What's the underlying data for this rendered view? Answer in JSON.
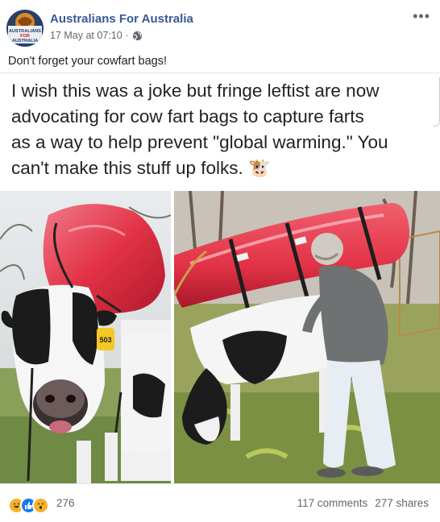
{
  "post": {
    "page_name": "Australians For Australia",
    "avatar_text": [
      "AUSTRALIANS",
      "FOR",
      "AUSTRALIA"
    ],
    "timestamp": "17 May at 07:10",
    "privacy_icon": "globe-icon",
    "more_icon": "more-options-icon",
    "caption": "Don't forget your cowfart bags!"
  },
  "image": {
    "text_lines": [
      "I wish this was a joke but fringe leftist are now",
      "advocating for cow fart bags to capture farts",
      "as a way to help prevent \"global warming.\" You",
      "can't make this stuff up folks. 🐮"
    ],
    "ear_tag": "503"
  },
  "footer": {
    "reaction_icons": [
      "haha-icon",
      "like-icon",
      "wow-icon"
    ],
    "reaction_count": "276",
    "comments": "117 comments",
    "shares": "277 shares"
  },
  "colors": {
    "link": "#385898",
    "meta": "#606770",
    "balloon": "#e23246",
    "like": "#1877f2",
    "reaction_yellow": "#f7b125"
  }
}
